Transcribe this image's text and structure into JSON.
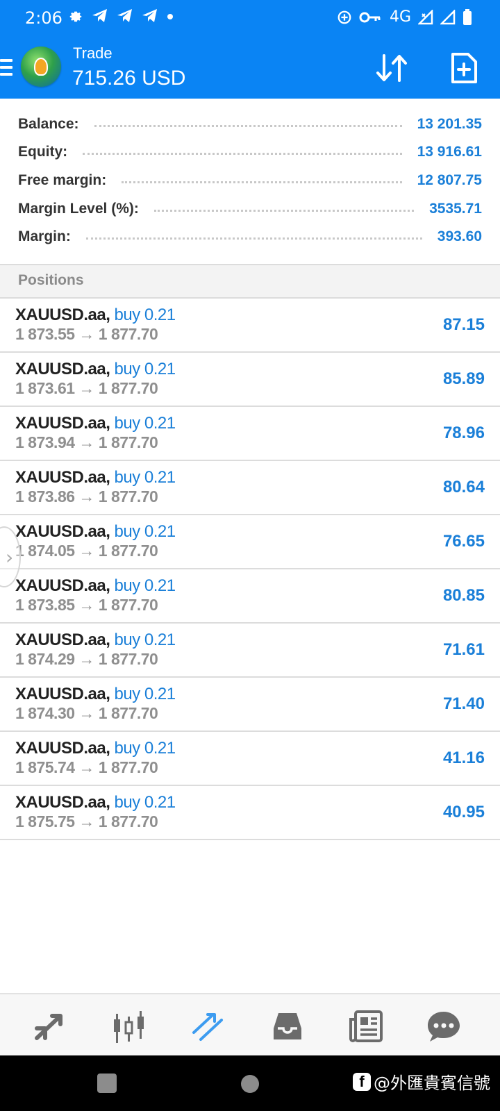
{
  "status_bar": {
    "time": "2:06",
    "network": "4G",
    "left_icons": [
      "gear-icon",
      "telegram-icon",
      "telegram-icon",
      "telegram-icon",
      "dot-icon"
    ],
    "right_icons": [
      "data-saver-icon",
      "key-icon",
      "signal-icon",
      "signal-icon",
      "battery-icon"
    ]
  },
  "appbar": {
    "title": "Trade",
    "subtitle": "715.26 USD",
    "icons": [
      "menu-icon",
      "app-logo",
      "sort-icon",
      "new-order-icon"
    ]
  },
  "summary": [
    {
      "label": "Balance:",
      "value": "13 201.35"
    },
    {
      "label": "Equity:",
      "value": "13 916.61"
    },
    {
      "label": "Free margin:",
      "value": "12 807.75"
    },
    {
      "label": "Margin Level (%):",
      "value": "3535.71"
    },
    {
      "label": "Margin:",
      "value": "393.60"
    }
  ],
  "positions_header": "Positions",
  "positions": [
    {
      "symbol": "XAUUSD.aa,",
      "type": "buy 0.21",
      "prices": "1 873.55 → 1 877.70",
      "profit": "87.15"
    },
    {
      "symbol": "XAUUSD.aa,",
      "type": "buy 0.21",
      "prices": "1 873.61 → 1 877.70",
      "profit": "85.89"
    },
    {
      "symbol": "XAUUSD.aa,",
      "type": "buy 0.21",
      "prices": "1 873.94 → 1 877.70",
      "profit": "78.96"
    },
    {
      "symbol": "XAUUSD.aa,",
      "type": "buy 0.21",
      "prices": "1 873.86 → 1 877.70",
      "profit": "80.64"
    },
    {
      "symbol": "XAUUSD.aa,",
      "type": "buy 0.21",
      "prices": "1 874.05 → 1 877.70",
      "profit": "76.65"
    },
    {
      "symbol": "XAUUSD.aa,",
      "type": "buy 0.21",
      "prices": "1 873.85 → 1 877.70",
      "profit": "80.85"
    },
    {
      "symbol": "XAUUSD.aa,",
      "type": "buy 0.21",
      "prices": "1 874.29 → 1 877.70",
      "profit": "71.61"
    },
    {
      "symbol": "XAUUSD.aa,",
      "type": "buy 0.21",
      "prices": "1 874.30 → 1 877.70",
      "profit": "71.40"
    },
    {
      "symbol": "XAUUSD.aa,",
      "type": "buy 0.21",
      "prices": "1 875.74 → 1 877.70",
      "profit": "41.16"
    },
    {
      "symbol": "XAUUSD.aa,",
      "type": "buy 0.21",
      "prices": "1 875.75 → 1 877.70",
      "profit": "40.95"
    }
  ],
  "bottom_nav": [
    {
      "icon": "quotes-icon",
      "active": false
    },
    {
      "icon": "chart-icon",
      "active": false
    },
    {
      "icon": "trade-icon",
      "active": true
    },
    {
      "icon": "history-icon",
      "active": false
    },
    {
      "icon": "news-icon",
      "active": false
    },
    {
      "icon": "messages-icon",
      "active": false
    }
  ],
  "watermark": "@外匯貴賓信號",
  "colors": {
    "primary": "#0a84f4",
    "value_blue": "#1a7fd8",
    "active_nav": "#3d9cf0",
    "inactive_nav": "#6b6b6b"
  }
}
